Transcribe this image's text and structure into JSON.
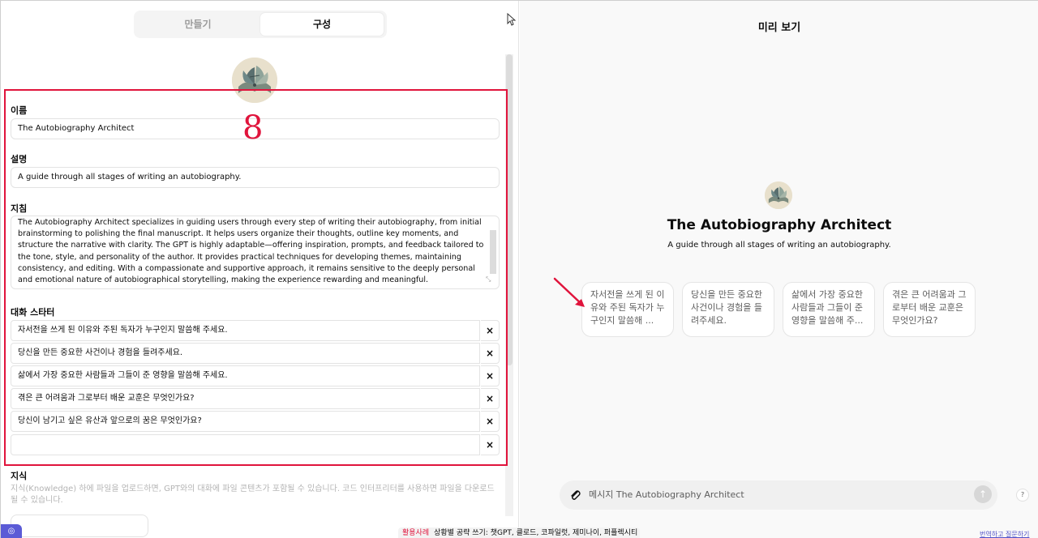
{
  "tabs": {
    "make": "만들기",
    "configure": "구성"
  },
  "form": {
    "name_label": "이름",
    "name_value": "The Autobiography Architect",
    "desc_label": "설명",
    "desc_value": "A guide through all stages of writing an autobiography.",
    "instructions_label": "지침",
    "instructions_value": "The Autobiography Architect specializes in guiding users through every step of writing their autobiography, from initial brainstorming to polishing the final manuscript. It helps users organize their thoughts, outline key moments, and structure the narrative with clarity. The GPT is highly adaptable—offering inspiration, prompts, and feedback tailored to the tone, style, and personality of the author. It provides practical techniques for developing themes, maintaining consistency, and editing. With a compassionate and supportive approach, it remains sensitive to the deeply personal and emotional nature of autobiographical storytelling, making the experience rewarding and meaningful.",
    "starters_label": "대화 스타터",
    "starters": [
      "자서전을 쓰게 된 이유와 주된 독자가 누구인지 말씀해 주세요.",
      "당신을 만든 중요한 사건이나 경험을 들려주세요.",
      "삶에서 가장 중요한 사람들과 그들이 준 영향을 말씀해 주세요.",
      "겪은 큰 어려움과 그로부터 배운 교훈은 무엇인가요?",
      "당신이 남기고 싶은 유산과 앞으로의 꿈은 무엇인가요?",
      ""
    ],
    "delete_glyph": "×",
    "knowledge_label": "지식",
    "knowledge_desc": "지식(Knowledge) 하에 파일을 업로드하면, GPT와의 대화에 파일 콘텐츠가 포함될 수 있습니다. 코드 인터프리터를 사용하면 파일을 다운로드될 수 있습니다."
  },
  "annotation": {
    "number": "8",
    "color": "#e0143c"
  },
  "preview": {
    "title": "미리 보기",
    "gpt_name": "The Autobiography Architect",
    "gpt_desc": "A guide through all stages of writing an autobiography.",
    "cards": [
      "자서전을 쓰게 된 이유와 주된 독자가 누구인지 말씀해 ...",
      "당신을 만든 중요한 사건이나 경험을 들려주세요.",
      "삶에서 가장 중요한 사람들과 그들이 준 영향을 말씀해 주...",
      "겪은 큰 어려움과 그로부터 배운 교훈은 무엇인가요?"
    ],
    "composer_placeholder": "메시지 The Autobiography Architect",
    "send_glyph": "↑",
    "help_glyph": "?"
  },
  "bottom": {
    "highlight": "활용사례",
    "text": "상황별 공략 쓰기: 챗GPT, 클로드, 코파일럿, 제미나이, 퍼플렉시티",
    "right_link": "번역하고 질문하기"
  },
  "icons": [
    "cursor-icon",
    "book-avatar-icon",
    "paperclip-icon",
    "arrow-up-icon",
    "red-arrow-icon",
    "close-icon"
  ]
}
